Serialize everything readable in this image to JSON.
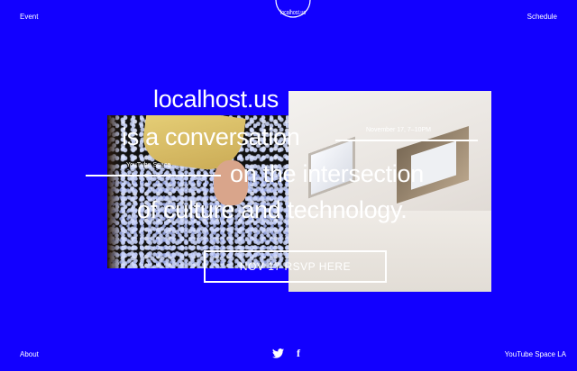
{
  "header": {
    "left_link": "Event",
    "right_link": "Schedule",
    "logo_text": "localhost.us"
  },
  "hero": {
    "line1": "localhost.us",
    "line2": "is a conversation",
    "line3": "on the intersection",
    "line4": "of culture and technology.",
    "caption_left": "YouTube Space",
    "caption_right": "November 17, 7–10PM",
    "rsvp_label": "NOV 17 RSVP HERE"
  },
  "footer": {
    "left_link": "About",
    "right_link": "YouTube Space LA",
    "social": [
      {
        "icon": "twitter-icon"
      },
      {
        "icon": "facebook-icon",
        "glyph": "f"
      }
    ]
  },
  "colors": {
    "background": "#1200ff",
    "text": "#ffffff"
  }
}
